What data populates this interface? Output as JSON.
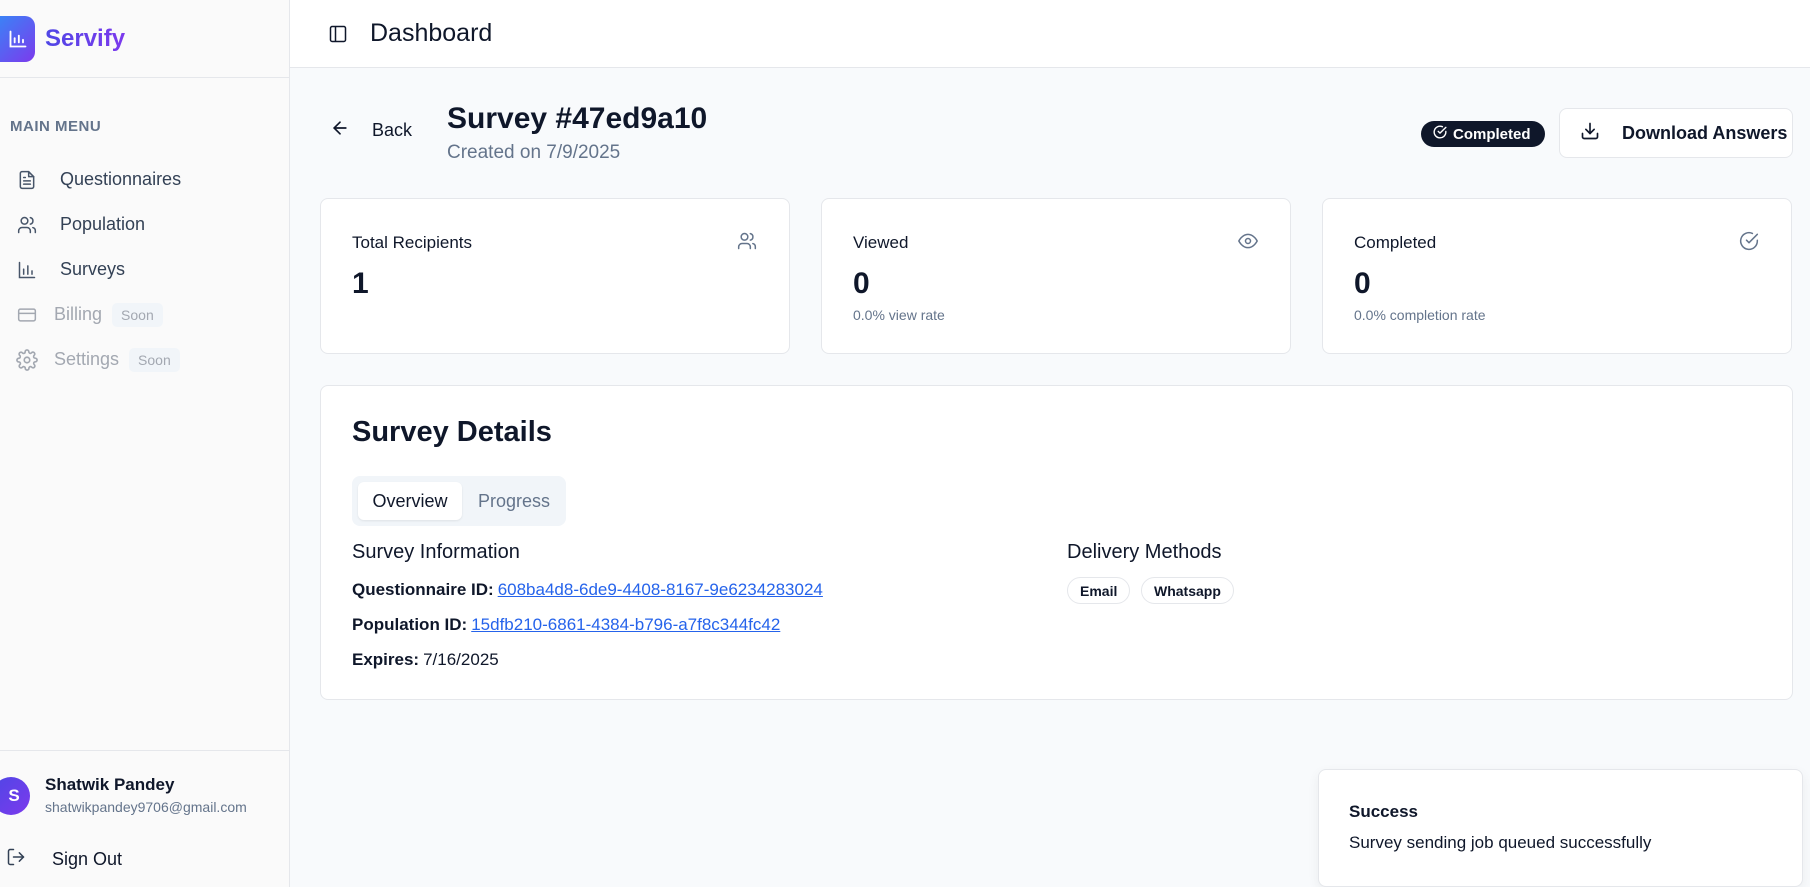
{
  "app": {
    "name": "Servify"
  },
  "sidebar": {
    "menu_title": "MAIN MENU",
    "items": [
      {
        "label": "Questionnaires",
        "icon": "file-text-icon"
      },
      {
        "label": "Population",
        "icon": "users-icon"
      },
      {
        "label": "Surveys",
        "icon": "bar-chart-icon"
      },
      {
        "label": "Billing",
        "icon": "credit-card-icon",
        "badge": "Soon"
      },
      {
        "label": "Settings",
        "icon": "gear-icon",
        "badge": "Soon"
      }
    ],
    "user": {
      "initial": "S",
      "name": "Shatwik Pandey",
      "email": "shatwikpandey9706@gmail.com"
    },
    "sign_out": "Sign Out"
  },
  "topbar": {
    "title": "Dashboard"
  },
  "header": {
    "back_label": "Back",
    "title": "Survey #47ed9a10",
    "created": "Created on 7/9/2025",
    "status": "Completed",
    "download_label": "Download Answers"
  },
  "stats": [
    {
      "label": "Total Recipients",
      "value": "1",
      "sub": "",
      "icon": "users-icon"
    },
    {
      "label": "Viewed",
      "value": "0",
      "sub": "0.0% view rate",
      "icon": "eye-icon"
    },
    {
      "label": "Completed",
      "value": "0",
      "sub": "0.0% completion rate",
      "icon": "check-circle-icon"
    }
  ],
  "details": {
    "title": "Survey Details",
    "tabs": [
      "Overview",
      "Progress"
    ],
    "info_title": "Survey Information",
    "questionnaire_label": "Questionnaire ID:",
    "questionnaire_id": "608ba4d8-6de9-4408-8167-9e6234283024",
    "population_label": "Population ID:",
    "population_id": "15dfb210-6861-4384-b796-a7f8c344fc42",
    "expires_label": "Expires:",
    "expires": "7/16/2025",
    "delivery_title": "Delivery Methods",
    "delivery_methods": [
      "Email",
      "Whatsapp"
    ]
  },
  "toast": {
    "title": "Success",
    "message": "Survey sending job queued successfully"
  },
  "colors": {
    "accent": "#4f46e5",
    "accent2": "#7c3aed",
    "link": "#2563eb",
    "badge_bg": "#0f172a"
  }
}
